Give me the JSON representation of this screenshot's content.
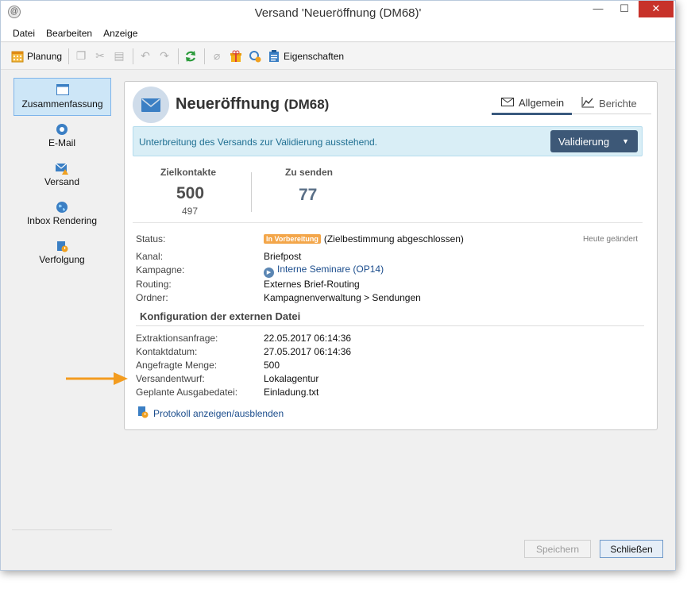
{
  "window": {
    "title": "Versand 'Neueröffnung (DM68)'",
    "controls": {
      "minimize": "—",
      "maximize": "☐",
      "close": "✕"
    }
  },
  "menu": [
    "Datei",
    "Bearbeiten",
    "Anzeige"
  ],
  "toolbar": {
    "planning_label": "Planung",
    "properties_label": "Eigenschaften"
  },
  "sidebar": {
    "items": [
      {
        "label": "Zusammenfassung",
        "icon": "summary-icon",
        "active": true
      },
      {
        "label": "E-Mail",
        "icon": "email-icon"
      },
      {
        "label": "Versand",
        "icon": "delivery-icon"
      },
      {
        "label": "Inbox Rendering",
        "icon": "globe-icon"
      },
      {
        "label": "Verfolgung",
        "icon": "tracking-icon"
      }
    ]
  },
  "header": {
    "title": "Neueröffnung",
    "code": "(DM68)",
    "tabs": [
      {
        "label": "Allgemein",
        "active": true
      },
      {
        "label": "Berichte",
        "active": false
      }
    ]
  },
  "alert": {
    "text": "Unterbreitung des Versands zur Validierung ausstehend.",
    "button": "Validierung"
  },
  "stats": {
    "target_label": "Zielkontakte",
    "target_value": "500",
    "target_sub": "497",
    "tosend_label": "Zu senden",
    "tosend_value": "77"
  },
  "details": {
    "status_label": "Status:",
    "status_badge": "In Vorbereitung",
    "status_text": "(Zielbestimmung abgeschlossen)",
    "changed": "Heute geändert",
    "channel_label": "Kanal:",
    "channel_value": "Briefpost",
    "campaign_label": "Kampagne:",
    "campaign_value": "Interne Seminare (OP14)",
    "routing_label": "Routing:",
    "routing_value": "Externes Brief-Routing",
    "folder_label": "Ordner:",
    "folder_value": "Kampagnenverwaltung > Sendungen"
  },
  "external": {
    "section_title": "Konfiguration der externen Datei",
    "rows": [
      {
        "label": "Extraktionsanfrage:",
        "value": "22.05.2017 06:14:36"
      },
      {
        "label": "Kontaktdatum:",
        "value": "27.05.2017 06:14:36"
      },
      {
        "label": "Angefragte Menge:",
        "value": "500"
      },
      {
        "label": "Versandentwurf:",
        "value": "Lokalagentur"
      },
      {
        "label": "Geplante Ausgabedatei:",
        "value": "Einladung.txt"
      }
    ],
    "log_link": "Protokoll anzeigen/ausblenden"
  },
  "footer": {
    "save": "Speichern",
    "close": "Schließen"
  },
  "colors": {
    "accent": "#3d5877",
    "alert_bg": "#d9eef6",
    "status_badge": "#f3a64a",
    "annotation_arrow": "#f39c1f"
  }
}
